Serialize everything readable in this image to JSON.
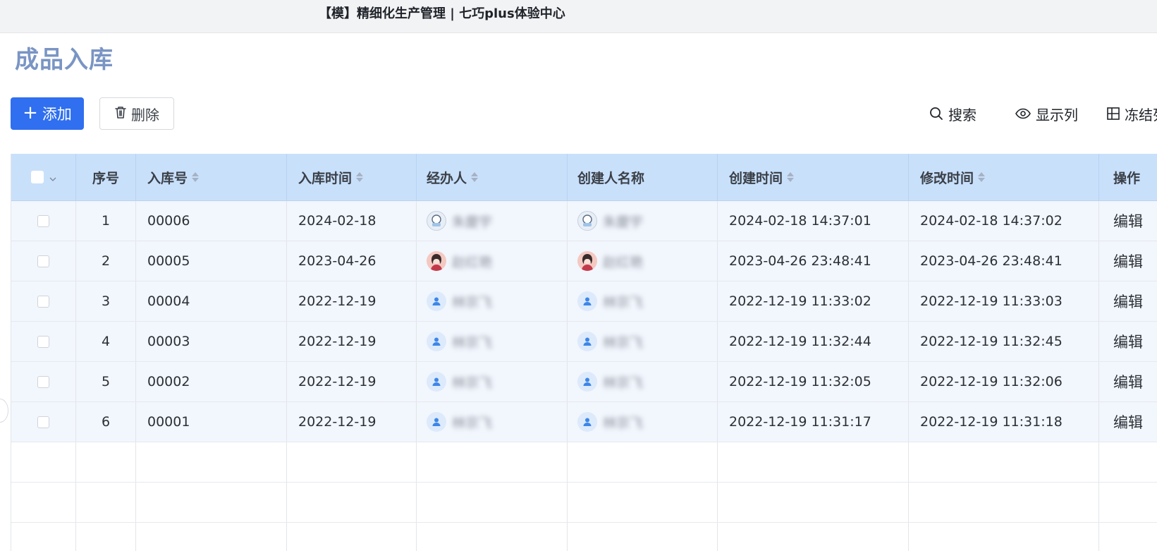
{
  "window": {
    "title": "【模】精细化生产管理 | 七巧plus体验中心"
  },
  "page": {
    "title": "成品入库"
  },
  "toolbar": {
    "add_label": "添加",
    "delete_label": "删除",
    "search_label": "搜索",
    "columns_label": "显示列",
    "freeze_label": "冻结列"
  },
  "table": {
    "headers": {
      "seq": "序号",
      "no": "入库号",
      "date": "入库时间",
      "handler": "经办人",
      "creator": "创建人名称",
      "created": "创建时间",
      "modified": "修改时间",
      "action": "操作"
    },
    "rows": [
      {
        "seq": "1",
        "no": "00006",
        "date": "2024-02-18",
        "handler": "朱慶宇",
        "creator": "朱慶宇",
        "created": "2024-02-18 14:37:01",
        "modified": "2024-02-18 14:37:02",
        "action": "编辑",
        "avatar": "cartoon"
      },
      {
        "seq": "2",
        "no": "00005",
        "date": "2023-04-26",
        "handler": "赵红艳",
        "creator": "赵红艳",
        "created": "2023-04-26 23:48:41",
        "modified": "2023-04-26 23:48:41",
        "action": "编辑",
        "avatar": "pink"
      },
      {
        "seq": "3",
        "no": "00004",
        "date": "2022-12-19",
        "handler": "林宗飞",
        "creator": "林宗飞",
        "created": "2022-12-19 11:33:02",
        "modified": "2022-12-19 11:33:03",
        "action": "编辑",
        "avatar": "default"
      },
      {
        "seq": "4",
        "no": "00003",
        "date": "2022-12-19",
        "handler": "林宗飞",
        "creator": "林宗飞",
        "created": "2022-12-19 11:32:44",
        "modified": "2022-12-19 11:32:45",
        "action": "编辑",
        "avatar": "default"
      },
      {
        "seq": "5",
        "no": "00002",
        "date": "2022-12-19",
        "handler": "林宗飞",
        "creator": "林宗飞",
        "created": "2022-12-19 11:32:05",
        "modified": "2022-12-19 11:32:06",
        "action": "编辑",
        "avatar": "default"
      },
      {
        "seq": "6",
        "no": "00001",
        "date": "2022-12-19",
        "handler": "林宗飞",
        "creator": "林宗飞",
        "created": "2022-12-19 11:31:17",
        "modified": "2022-12-19 11:31:18",
        "action": "编辑",
        "avatar": "default"
      }
    ]
  },
  "colors": {
    "accent": "#2f6ff0",
    "header_bg": "#c9e0fb",
    "row_bg": "#f2f6fd",
    "title": "#7a95c4"
  },
  "icons": {
    "add": "plus-icon",
    "delete": "trash-icon",
    "search": "search-icon",
    "columns": "eye-icon",
    "freeze": "freeze-grid-icon",
    "default_avatar": "user-icon"
  }
}
